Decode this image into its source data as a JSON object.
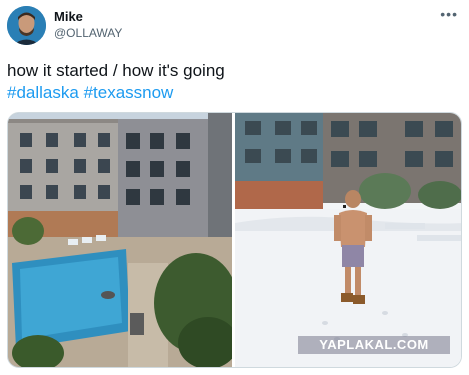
{
  "author": {
    "name": "Mike",
    "handle": "@OLLAWAY",
    "avatar_icon": "avatar-photo"
  },
  "more_icon": "more-options-icon",
  "tweet": {
    "text": "how it started / how it's going",
    "hashtags": [
      "#dallaska",
      "#texassnow"
    ]
  },
  "media": {
    "left_image": "apartment courtyard pool, summer",
    "right_image": "man in shorts standing in snow-covered courtyard",
    "watermark": "YAPLAKAL.COM"
  },
  "colors": {
    "link": "#1d9bf0",
    "secondary_text": "#536471"
  }
}
